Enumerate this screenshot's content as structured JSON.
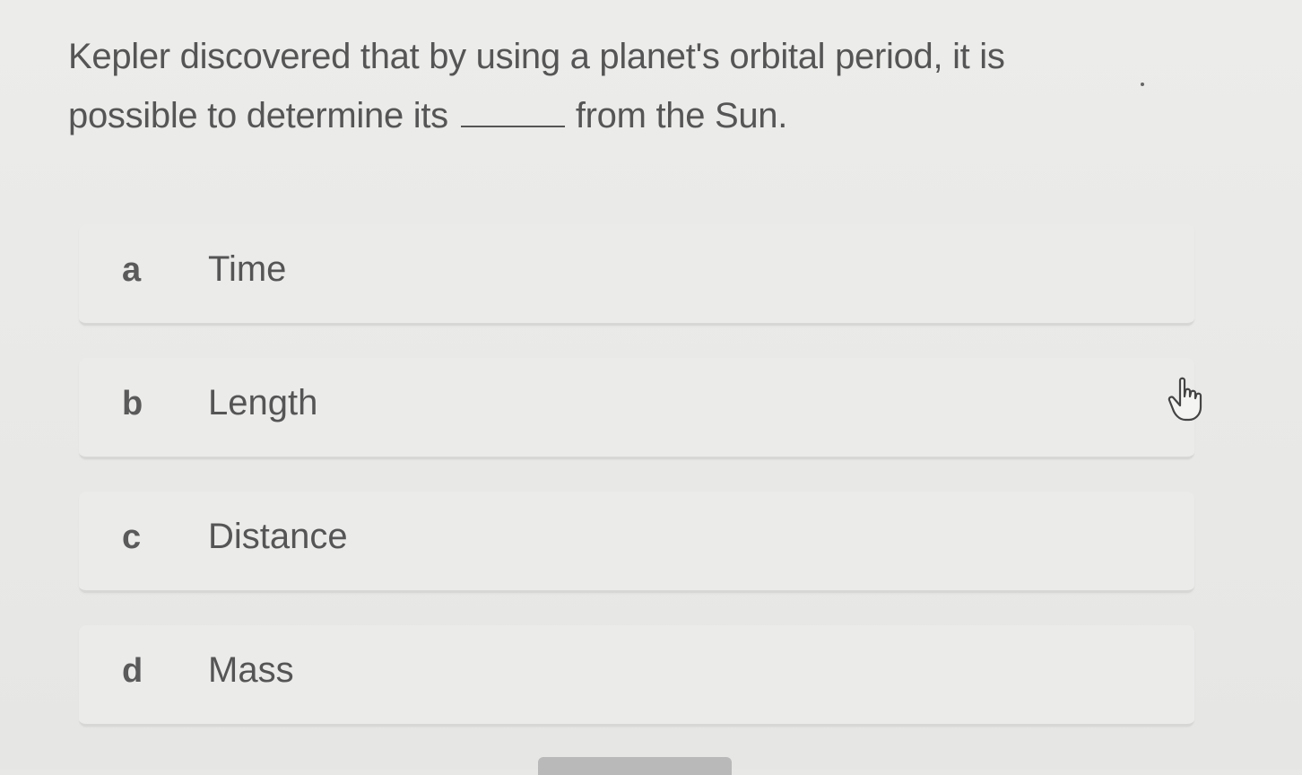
{
  "question": {
    "text_before": "Kepler discovered that by using a planet's orbital period, it is possible to determine its",
    "text_after": "from the Sun."
  },
  "options": [
    {
      "letter": "a",
      "label": "Time"
    },
    {
      "letter": "b",
      "label": "Length"
    },
    {
      "letter": "c",
      "label": "Distance"
    },
    {
      "letter": "d",
      "label": "Mass"
    }
  ],
  "icons": {
    "cursor": "hand-pointer-icon"
  },
  "colors": {
    "background": "#e9e9e7",
    "text": "#555555",
    "option_background": "#ebebea",
    "option_border": "#d7d7d5"
  }
}
